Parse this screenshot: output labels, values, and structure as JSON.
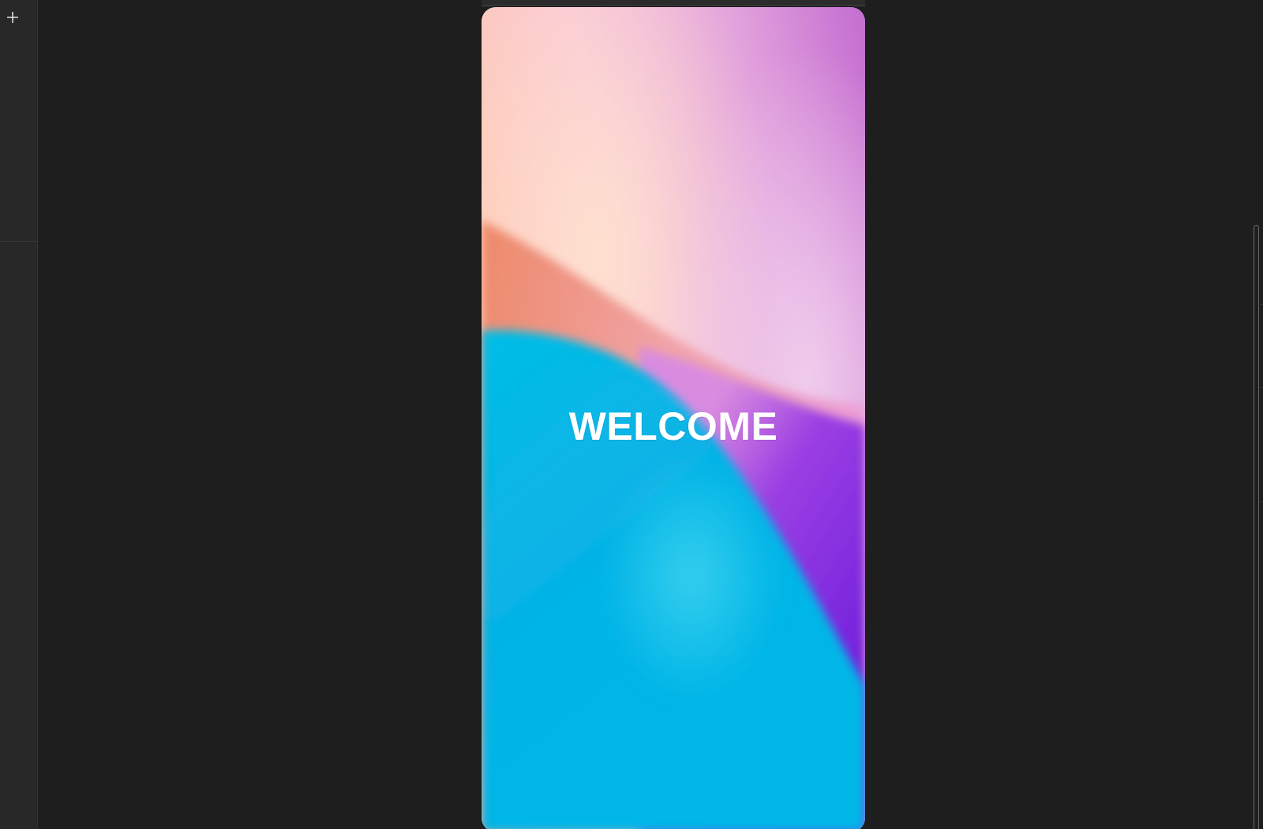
{
  "toolbar": {
    "add_icon": "plus-icon"
  },
  "canvas": {
    "frame": {
      "title": "WELCOME",
      "gradient_colors": {
        "pink_top": "#d98fd0",
        "violet_top_right": "#c470d2",
        "peach": "#ffd6c0",
        "coral": "#ee8a70",
        "cyan": "#00b8e8",
        "light_cyan": "#2fcbe8",
        "purple": "#7a22dc",
        "magenta_pink": "#e48bd8"
      }
    }
  },
  "scrollbar": {
    "icon": "vertical-scrollbar"
  }
}
